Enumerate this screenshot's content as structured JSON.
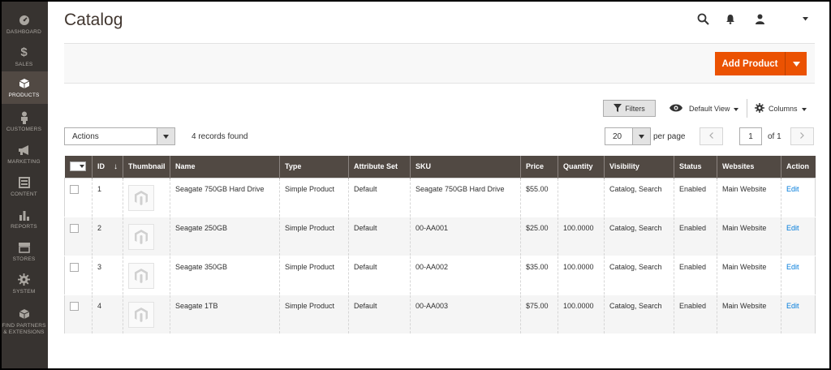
{
  "sidebar": {
    "items": [
      {
        "label": "DASHBOARD",
        "icon": "dashboard-icon"
      },
      {
        "label": "SALES",
        "icon": "dollar-icon"
      },
      {
        "label": "PRODUCTS",
        "icon": "cube-icon",
        "active": true
      },
      {
        "label": "CUSTOMERS",
        "icon": "person-icon"
      },
      {
        "label": "MARKETING",
        "icon": "megaphone-icon"
      },
      {
        "label": "CONTENT",
        "icon": "layout-icon"
      },
      {
        "label": "REPORTS",
        "icon": "bar-chart-icon"
      },
      {
        "label": "STORES",
        "icon": "store-icon"
      },
      {
        "label": "SYSTEM",
        "icon": "gear-icon"
      },
      {
        "label": "FIND PARTNERS & EXTENSIONS",
        "icon": "box-icon"
      }
    ]
  },
  "header": {
    "title": "Catalog",
    "add_product_label": "Add Product"
  },
  "toolbar": {
    "filters_label": "Filters",
    "view_label": "Default View",
    "columns_label": "Columns",
    "actions_label": "Actions",
    "records_found": "4 records found",
    "per_page_value": "20",
    "per_page_label": "per page",
    "current_page": "1",
    "of_pages": "of 1"
  },
  "grid": {
    "columns": [
      "ID",
      "Thumbnail",
      "Name",
      "Type",
      "Attribute Set",
      "SKU",
      "Price",
      "Quantity",
      "Visibility",
      "Status",
      "Websites",
      "Action"
    ],
    "rows": [
      {
        "id": "1",
        "name": "Seagate 750GB Hard Drive",
        "type": "Simple Product",
        "attribute_set": "Default",
        "sku": "Seagate 750GB Hard Drive",
        "price": "$55.00",
        "quantity": "",
        "visibility": "Catalog, Search",
        "status": "Enabled",
        "websites": "Main Website",
        "action": "Edit"
      },
      {
        "id": "2",
        "name": "Seagate 250GB",
        "type": "Simple Product",
        "attribute_set": "Default",
        "sku": "00-AA001",
        "price": "$25.00",
        "quantity": "100.0000",
        "visibility": "Catalog, Search",
        "status": "Enabled",
        "websites": "Main Website",
        "action": "Edit"
      },
      {
        "id": "3",
        "name": "Seagate 350GB",
        "type": "Simple Product",
        "attribute_set": "Default",
        "sku": "00-AA002",
        "price": "$35.00",
        "quantity": "100.0000",
        "visibility": "Catalog, Search",
        "status": "Enabled",
        "websites": "Main Website",
        "action": "Edit"
      },
      {
        "id": "4",
        "name": "Seagate 1TB",
        "type": "Simple Product",
        "attribute_set": "Default",
        "sku": "00-AA003",
        "price": "$75.00",
        "quantity": "100.0000",
        "visibility": "Catalog, Search",
        "status": "Enabled",
        "websites": "Main Website",
        "action": "Edit"
      }
    ]
  },
  "colors": {
    "sidebar_bg": "#373330",
    "sidebar_active": "#514943",
    "accent": "#eb5202",
    "grid_header": "#514943",
    "link": "#007bdb"
  }
}
